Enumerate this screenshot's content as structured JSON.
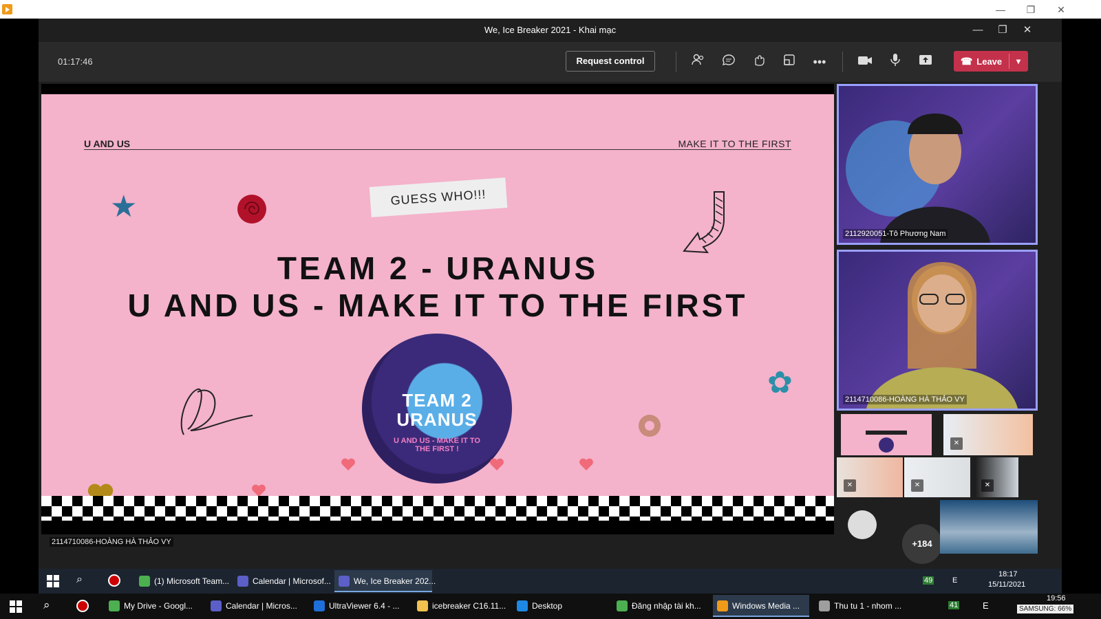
{
  "outer_window": {
    "controls": [
      "—",
      "❐",
      "✕"
    ]
  },
  "meeting": {
    "title": "We, Ice Breaker 2021 - Khai mạc",
    "timer": "01:17:46",
    "request_control": "Request control",
    "leave": "Leave",
    "toolbar_icons": [
      "participants-icon",
      "chat-icon",
      "reactions-icon",
      "rooms-icon",
      "more-icon",
      "camera-icon",
      "mic-icon",
      "share-icon"
    ]
  },
  "slide": {
    "left_header": "U AND US",
    "right_header": "MAKE IT TO THE FIRST",
    "sticker": "GUESS WHO!!!",
    "heading_1": "TEAM 2 - URANUS",
    "heading_2": "U AND US - MAKE IT TO THE FIRST",
    "logo_line_1": "TEAM 2",
    "logo_line_2": "URANUS",
    "logo_ring": "U AND US - MAKE IT TO THE FIRST !"
  },
  "presenter_label": "2114710086-HOÀNG HÀ THẢO VY",
  "participants": {
    "tile_1": "2112920051-Tô Phương Nam",
    "tile_2": "2114710086-HOÀNG HÀ THẢO VY",
    "overflow_count": "+184"
  },
  "taskbar_inner": {
    "items": [
      "(1) Microsoft Team...",
      "Calendar | Microsof...",
      "We, Ice Breaker 202..."
    ],
    "time": "18:17",
    "date": "15/11/2021",
    "tray": [
      "49",
      "E"
    ]
  },
  "taskbar_outer": {
    "items": [
      "My Drive - Googl...",
      "Calendar | Micros...",
      "UltraViewer 6.4 - ...",
      "icebreaker C16.11...",
      "Desktop",
      "Đăng nhập tài kh...",
      "Windows Media ...",
      "Thu tu 1 - nhom ..."
    ],
    "time": "19:56",
    "tray": [
      "41",
      "E"
    ],
    "battery": "SAMSUNG: 66%"
  },
  "colors": {
    "leave": "#c4314b",
    "slide_bg": "#f4b2cb",
    "tile_border": "#9aa0ff"
  }
}
